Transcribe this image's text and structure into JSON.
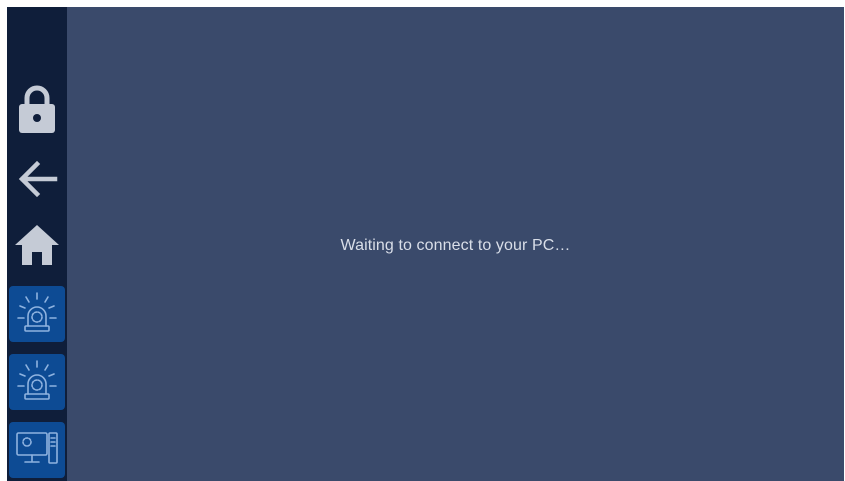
{
  "main": {
    "status_text": "Waiting to connect to your PC…"
  },
  "sidebar": {
    "items": [
      {
        "name": "lock",
        "icon": "lock-icon"
      },
      {
        "name": "back",
        "icon": "arrow-left-icon"
      },
      {
        "name": "home",
        "icon": "home-icon"
      },
      {
        "name": "alarm-1",
        "icon": "siren-icon"
      },
      {
        "name": "alarm-2",
        "icon": "siren-icon"
      },
      {
        "name": "pc",
        "icon": "computer-icon"
      }
    ]
  },
  "colors": {
    "background": "#3a4a6b",
    "sidebar": "#0f1e3a",
    "tile": "#0d4b94",
    "icon": "#c5cbd6",
    "tile_icon": "#8fb3e0"
  }
}
